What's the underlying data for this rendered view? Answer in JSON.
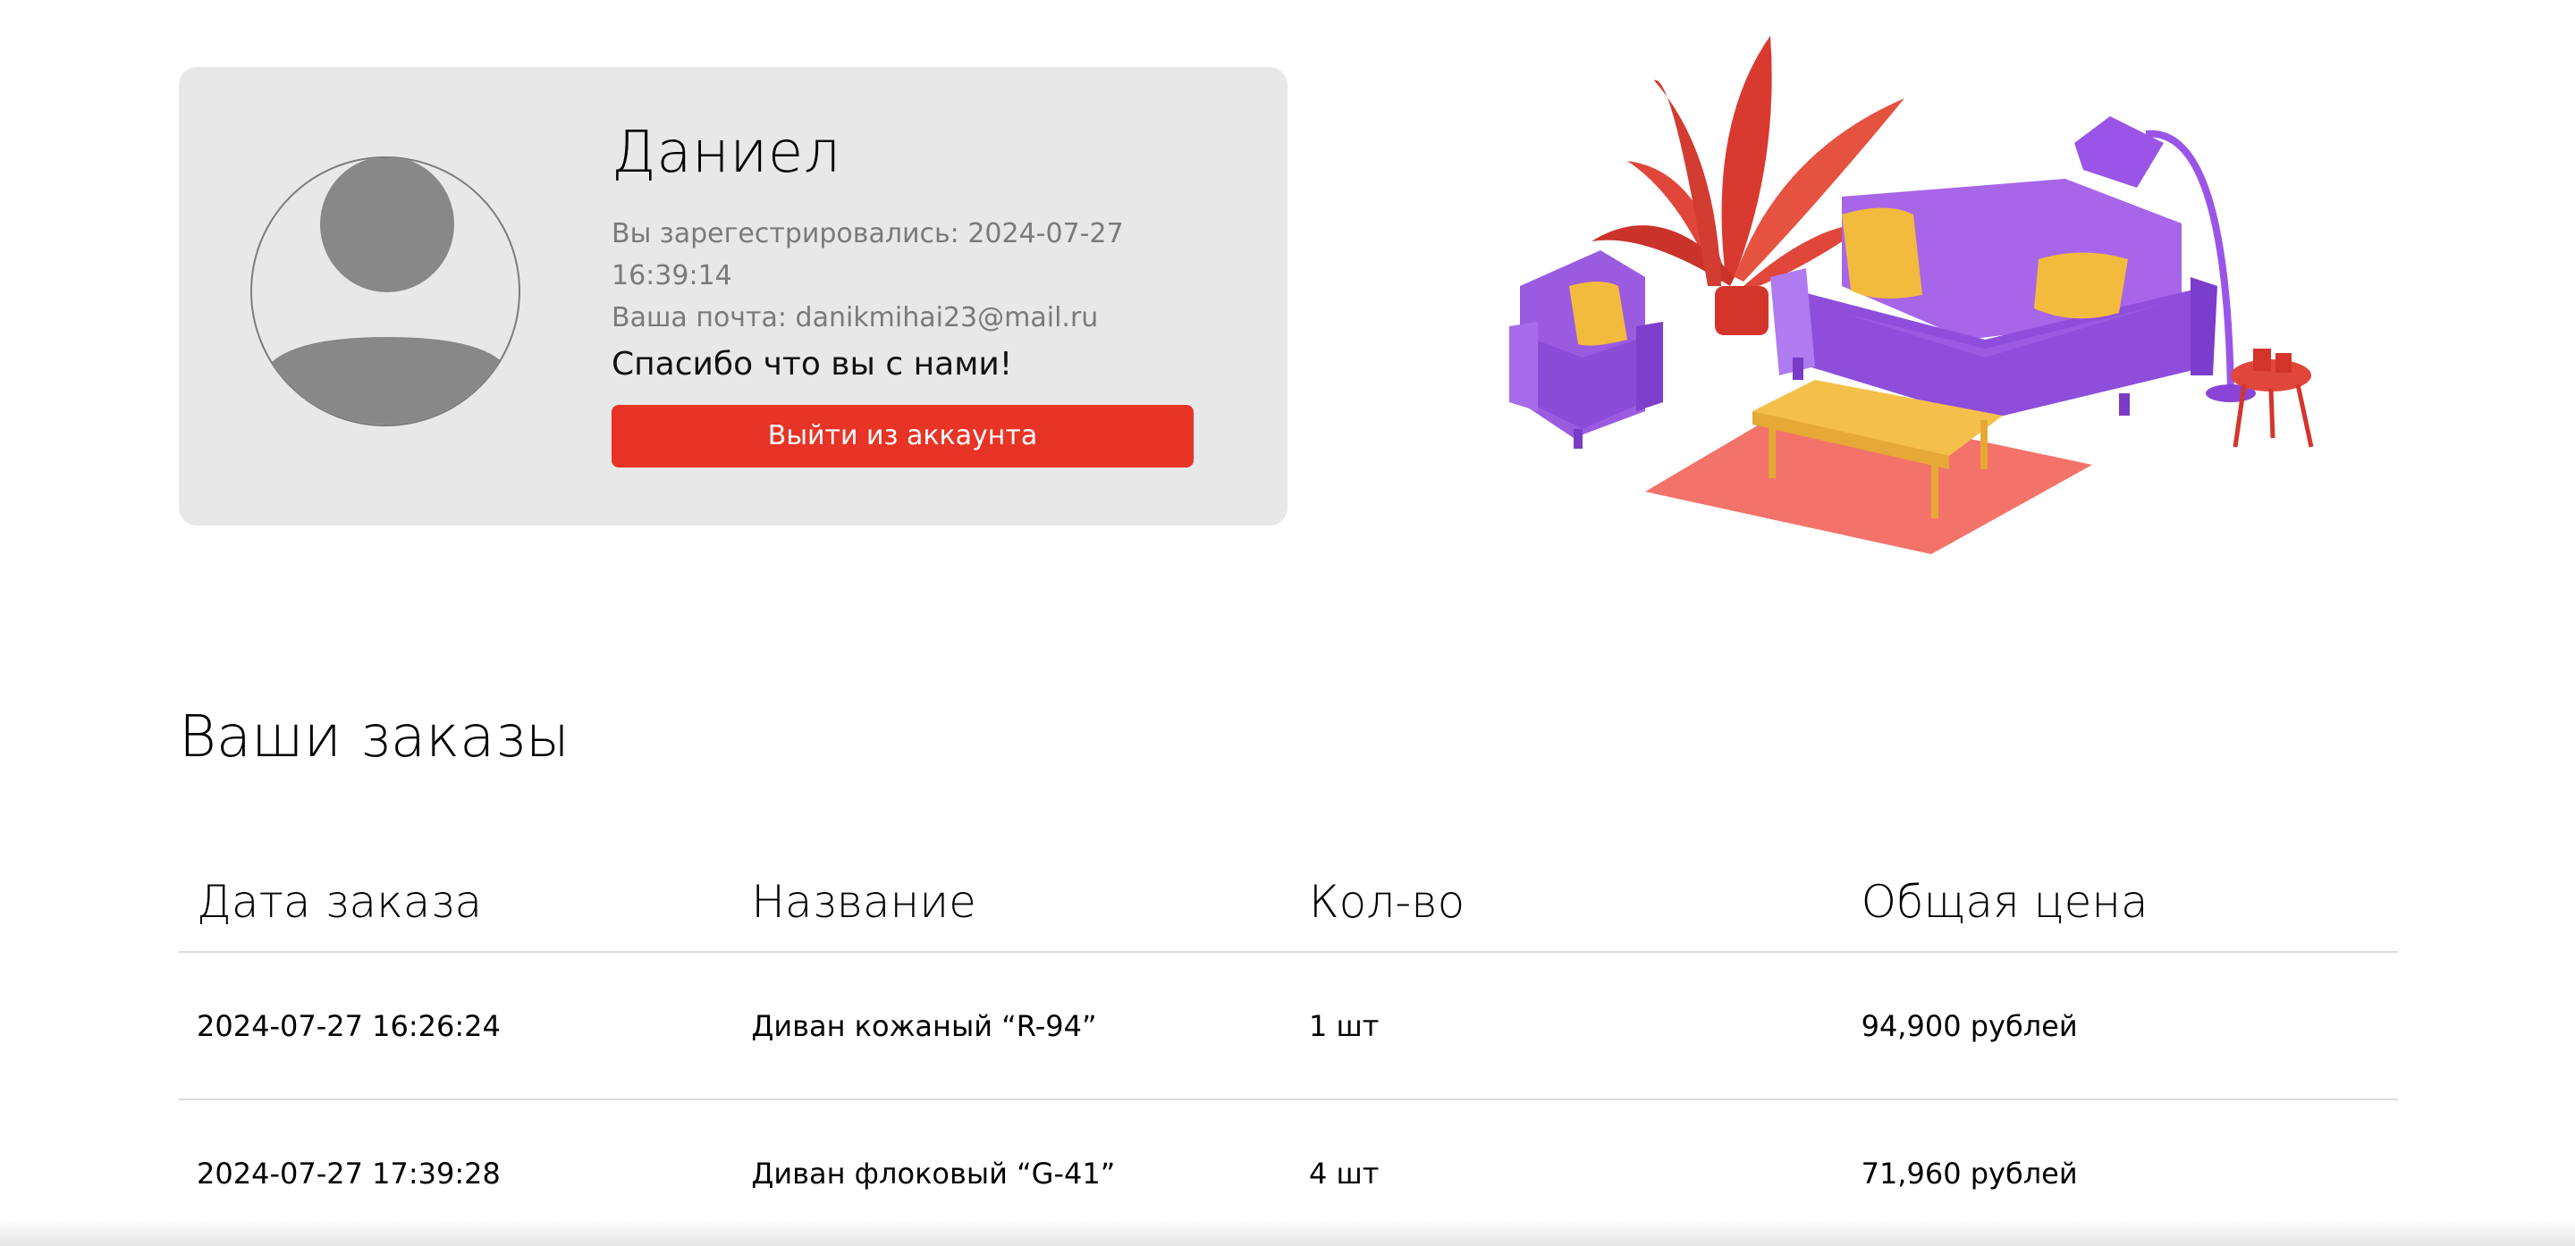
{
  "profile": {
    "name": "Даниел",
    "registered": "Вы зарегестрировались: 2024-07-27 16:39:14",
    "email": "Ваша почта: danikmihai23@mail.ru",
    "thanks": "Спасибо что вы с нами!",
    "logout_label": "Выйти из аккаунта"
  },
  "colors": {
    "accent": "#e83426",
    "card_bg": "#e8e8e8"
  },
  "orders": {
    "title": "Ваши заказы",
    "columns": [
      "Дата заказа",
      "Название",
      "Кол-во",
      "Общая цена"
    ],
    "rows": [
      [
        "2024-07-27 16:26:24",
        "Диван кожаный “R-94”",
        "1 шт",
        "94,900 рублей"
      ],
      [
        "2024-07-27 17:39:28",
        "Диван флоковый “G-41”",
        "4 шт",
        "71,960 рублей"
      ]
    ]
  }
}
